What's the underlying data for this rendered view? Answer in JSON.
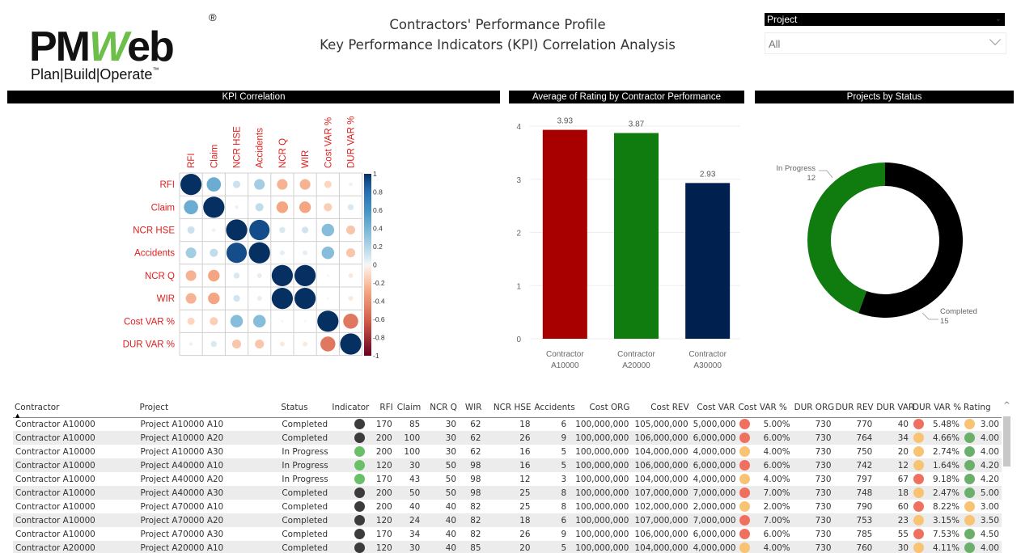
{
  "logo": {
    "word_pm": "PM",
    "word_w": "W",
    "word_eb": "eb",
    "registered": "®",
    "tagline": "Plan|Build|Operate",
    "tm": "™"
  },
  "header": {
    "title_line1": "Contractors' Performance Profile",
    "title_line2": "Key Performance Indicators (KPI) Correlation Analysis"
  },
  "slicer": {
    "label": "Project",
    "value": "All"
  },
  "panels": {
    "kpi_correlation": "KPI Correlation",
    "avg_rating": "Average of Rating by Contractor Performance",
    "projects_status": "Projects by Status"
  },
  "chart_data": [
    {
      "type": "heatmap",
      "title": "KPI Correlation",
      "variables": [
        "RFI",
        "Claim",
        "NCR HSE",
        "Accidents",
        "NCR Q",
        "WIR",
        "Cost VAR %",
        "DUR VAR %"
      ],
      "matrix": [
        [
          1.0,
          0.45,
          0.12,
          0.25,
          -0.25,
          -0.25,
          -0.12,
          0.03
        ],
        [
          0.45,
          1.0,
          0.03,
          0.15,
          -0.3,
          -0.3,
          -0.15,
          0.08
        ],
        [
          0.12,
          0.03,
          1.0,
          0.92,
          0.08,
          0.1,
          0.35,
          -0.18
        ],
        [
          0.25,
          0.15,
          0.92,
          1.0,
          0.05,
          0.05,
          0.35,
          -0.18
        ],
        [
          -0.25,
          -0.3,
          0.08,
          0.05,
          1.0,
          1.0,
          0.01,
          -0.05
        ],
        [
          -0.25,
          -0.3,
          0.1,
          0.05,
          1.0,
          1.0,
          0.01,
          -0.05
        ],
        [
          -0.12,
          -0.15,
          0.35,
          0.35,
          0.01,
          0.01,
          1.0,
          -0.5
        ],
        [
          0.03,
          0.08,
          -0.18,
          -0.18,
          -0.05,
          -0.05,
          -0.5,
          1.0
        ]
      ],
      "colorbar_ticks": [
        "1",
        "0.8",
        "0.6",
        "0.4",
        "0.2",
        "0",
        "-0.2",
        "-0.4",
        "-0.6",
        "-0.8",
        "-1"
      ],
      "range": [
        -1,
        1
      ]
    },
    {
      "type": "bar",
      "title": "Average of Rating by Contractor Performance",
      "categories": [
        "Contractor A10000",
        "Contractor A20000",
        "Contractor A30000"
      ],
      "category_lines": [
        [
          "Contractor",
          "A10000"
        ],
        [
          "Contractor",
          "A20000"
        ],
        [
          "Contractor",
          "A30000"
        ]
      ],
      "values": [
        3.93,
        3.87,
        2.93
      ],
      "value_labels": [
        "3.93",
        "3.87",
        "2.93"
      ],
      "colors": [
        "#a80000",
        "#107c10",
        "#002050"
      ],
      "ylim": [
        0,
        4
      ],
      "yticks": [
        "0",
        "1",
        "2",
        "3",
        "4"
      ],
      "grid": true
    },
    {
      "type": "pie",
      "title": "Projects by Status",
      "donut": true,
      "labels": [
        "Completed",
        "In Progress"
      ],
      "values": [
        15,
        12
      ],
      "colors": [
        "#000000",
        "#107c10"
      ]
    }
  ],
  "table": {
    "columns": [
      "Contractor",
      "Project",
      "Status",
      "Indicator",
      "RFI",
      "Claim",
      "NCR Q",
      "WIR",
      "NCR HSE",
      "Accidents",
      "Cost ORG",
      "Cost REV",
      "Cost VAR",
      "Cost VAR %",
      "DUR ORG",
      "DUR REV",
      "DUR VAR",
      "DUR VAR %",
      "Rating"
    ],
    "indicator_colors": {
      "dark": "#3c3c3c",
      "green": "#6abf69",
      "red": "#f07060",
      "amber": "#f8c372",
      "green2": "#6caf6c"
    },
    "rows": [
      {
        "contractor": "Contractor A10000",
        "project": "Project A10000 A10",
        "status": "Completed",
        "indicator": "dark",
        "rfi": "170",
        "claim": "85",
        "ncrq": "30",
        "wir": "62",
        "ncrhse": "18",
        "accidents": "6",
        "cost_org": "100,000,000",
        "cost_rev": "105,000,000",
        "cost_var": "5,000,000",
        "cost_var_pct_flag": "red",
        "cost_var_pct": "5.00%",
        "dur_org": "730",
        "dur_rev": "770",
        "dur_var": "40",
        "dur_var_pct_flag": "red",
        "dur_var_pct": "5.48%",
        "rating_flag": "amber",
        "rating": "3.00"
      },
      {
        "contractor": "Contractor A10000",
        "project": "Project A10000 A20",
        "status": "Completed",
        "indicator": "dark",
        "rfi": "200",
        "claim": "100",
        "ncrq": "30",
        "wir": "62",
        "ncrhse": "26",
        "accidents": "9",
        "cost_org": "100,000,000",
        "cost_rev": "106,000,000",
        "cost_var": "6,000,000",
        "cost_var_pct_flag": "red",
        "cost_var_pct": "6.00%",
        "dur_org": "730",
        "dur_rev": "764",
        "dur_var": "34",
        "dur_var_pct_flag": "amber",
        "dur_var_pct": "4.66%",
        "rating_flag": "green2",
        "rating": "4.00"
      },
      {
        "contractor": "Contractor A10000",
        "project": "Project A10000 A30",
        "status": "In Progress",
        "indicator": "green",
        "rfi": "200",
        "claim": "100",
        "ncrq": "30",
        "wir": "62",
        "ncrhse": "16",
        "accidents": "5",
        "cost_org": "100,000,000",
        "cost_rev": "104,000,000",
        "cost_var": "4,000,000",
        "cost_var_pct_flag": "amber",
        "cost_var_pct": "4.00%",
        "dur_org": "730",
        "dur_rev": "750",
        "dur_var": "20",
        "dur_var_pct_flag": "amber",
        "dur_var_pct": "2.74%",
        "rating_flag": "green2",
        "rating": "4.00"
      },
      {
        "contractor": "Contractor A10000",
        "project": "Project A40000 A10",
        "status": "In Progress",
        "indicator": "green",
        "rfi": "120",
        "claim": "30",
        "ncrq": "50",
        "wir": "98",
        "ncrhse": "16",
        "accidents": "5",
        "cost_org": "100,000,000",
        "cost_rev": "106,000,000",
        "cost_var": "6,000,000",
        "cost_var_pct_flag": "red",
        "cost_var_pct": "6.00%",
        "dur_org": "730",
        "dur_rev": "742",
        "dur_var": "12",
        "dur_var_pct_flag": "amber",
        "dur_var_pct": "1.64%",
        "rating_flag": "green2",
        "rating": "4.20"
      },
      {
        "contractor": "Contractor A10000",
        "project": "Project A40000 A20",
        "status": "In Progress",
        "indicator": "green",
        "rfi": "170",
        "claim": "43",
        "ncrq": "50",
        "wir": "98",
        "ncrhse": "12",
        "accidents": "3",
        "cost_org": "100,000,000",
        "cost_rev": "104,000,000",
        "cost_var": "4,000,000",
        "cost_var_pct_flag": "amber",
        "cost_var_pct": "4.00%",
        "dur_org": "730",
        "dur_rev": "797",
        "dur_var": "67",
        "dur_var_pct_flag": "red",
        "dur_var_pct": "9.18%",
        "rating_flag": "green2",
        "rating": "4.20"
      },
      {
        "contractor": "Contractor A10000",
        "project": "Project A40000 A30",
        "status": "Completed",
        "indicator": "dark",
        "rfi": "200",
        "claim": "50",
        "ncrq": "50",
        "wir": "98",
        "ncrhse": "25",
        "accidents": "8",
        "cost_org": "100,000,000",
        "cost_rev": "107,000,000",
        "cost_var": "7,000,000",
        "cost_var_pct_flag": "red",
        "cost_var_pct": "7.00%",
        "dur_org": "730",
        "dur_rev": "748",
        "dur_var": "18",
        "dur_var_pct_flag": "amber",
        "dur_var_pct": "2.47%",
        "rating_flag": "green2",
        "rating": "5.00"
      },
      {
        "contractor": "Contractor A10000",
        "project": "Project A70000 A10",
        "status": "Completed",
        "indicator": "dark",
        "rfi": "200",
        "claim": "40",
        "ncrq": "40",
        "wir": "82",
        "ncrhse": "25",
        "accidents": "8",
        "cost_org": "100,000,000",
        "cost_rev": "102,000,000",
        "cost_var": "2,000,000",
        "cost_var_pct_flag": "amber",
        "cost_var_pct": "2.00%",
        "dur_org": "730",
        "dur_rev": "790",
        "dur_var": "60",
        "dur_var_pct_flag": "red",
        "dur_var_pct": "8.22%",
        "rating_flag": "amber",
        "rating": "3.00"
      },
      {
        "contractor": "Contractor A10000",
        "project": "Project A70000 A20",
        "status": "Completed",
        "indicator": "dark",
        "rfi": "120",
        "claim": "24",
        "ncrq": "40",
        "wir": "82",
        "ncrhse": "18",
        "accidents": "6",
        "cost_org": "100,000,000",
        "cost_rev": "107,000,000",
        "cost_var": "7,000,000",
        "cost_var_pct_flag": "red",
        "cost_var_pct": "7.00%",
        "dur_org": "730",
        "dur_rev": "753",
        "dur_var": "23",
        "dur_var_pct_flag": "amber",
        "dur_var_pct": "3.15%",
        "rating_flag": "amber",
        "rating": "3.50"
      },
      {
        "contractor": "Contractor A10000",
        "project": "Project A70000 A30",
        "status": "Completed",
        "indicator": "dark",
        "rfi": "170",
        "claim": "34",
        "ncrq": "40",
        "wir": "82",
        "ncrhse": "26",
        "accidents": "9",
        "cost_org": "100,000,000",
        "cost_rev": "106,000,000",
        "cost_var": "6,000,000",
        "cost_var_pct_flag": "red",
        "cost_var_pct": "6.00%",
        "dur_org": "730",
        "dur_rev": "785",
        "dur_var": "55",
        "dur_var_pct_flag": "red",
        "dur_var_pct": "7.53%",
        "rating_flag": "green2",
        "rating": "4.50"
      },
      {
        "contractor": "Contractor A20000",
        "project": "Project A20000 A10",
        "status": "Completed",
        "indicator": "dark",
        "rfi": "120",
        "claim": "30",
        "ncrq": "40",
        "wir": "85",
        "ncrhse": "20",
        "accidents": "5",
        "cost_org": "100,000,000",
        "cost_rev": "104,000,000",
        "cost_var": "4,000,000",
        "cost_var_pct_flag": "amber",
        "cost_var_pct": "4.00%",
        "dur_org": "730",
        "dur_rev": "760",
        "dur_var": "30",
        "dur_var_pct_flag": "amber",
        "dur_var_pct": "4.11%",
        "rating_flag": "green2",
        "rating": "4.00"
      }
    ]
  },
  "scrollbar": {
    "up_icon": "^"
  }
}
